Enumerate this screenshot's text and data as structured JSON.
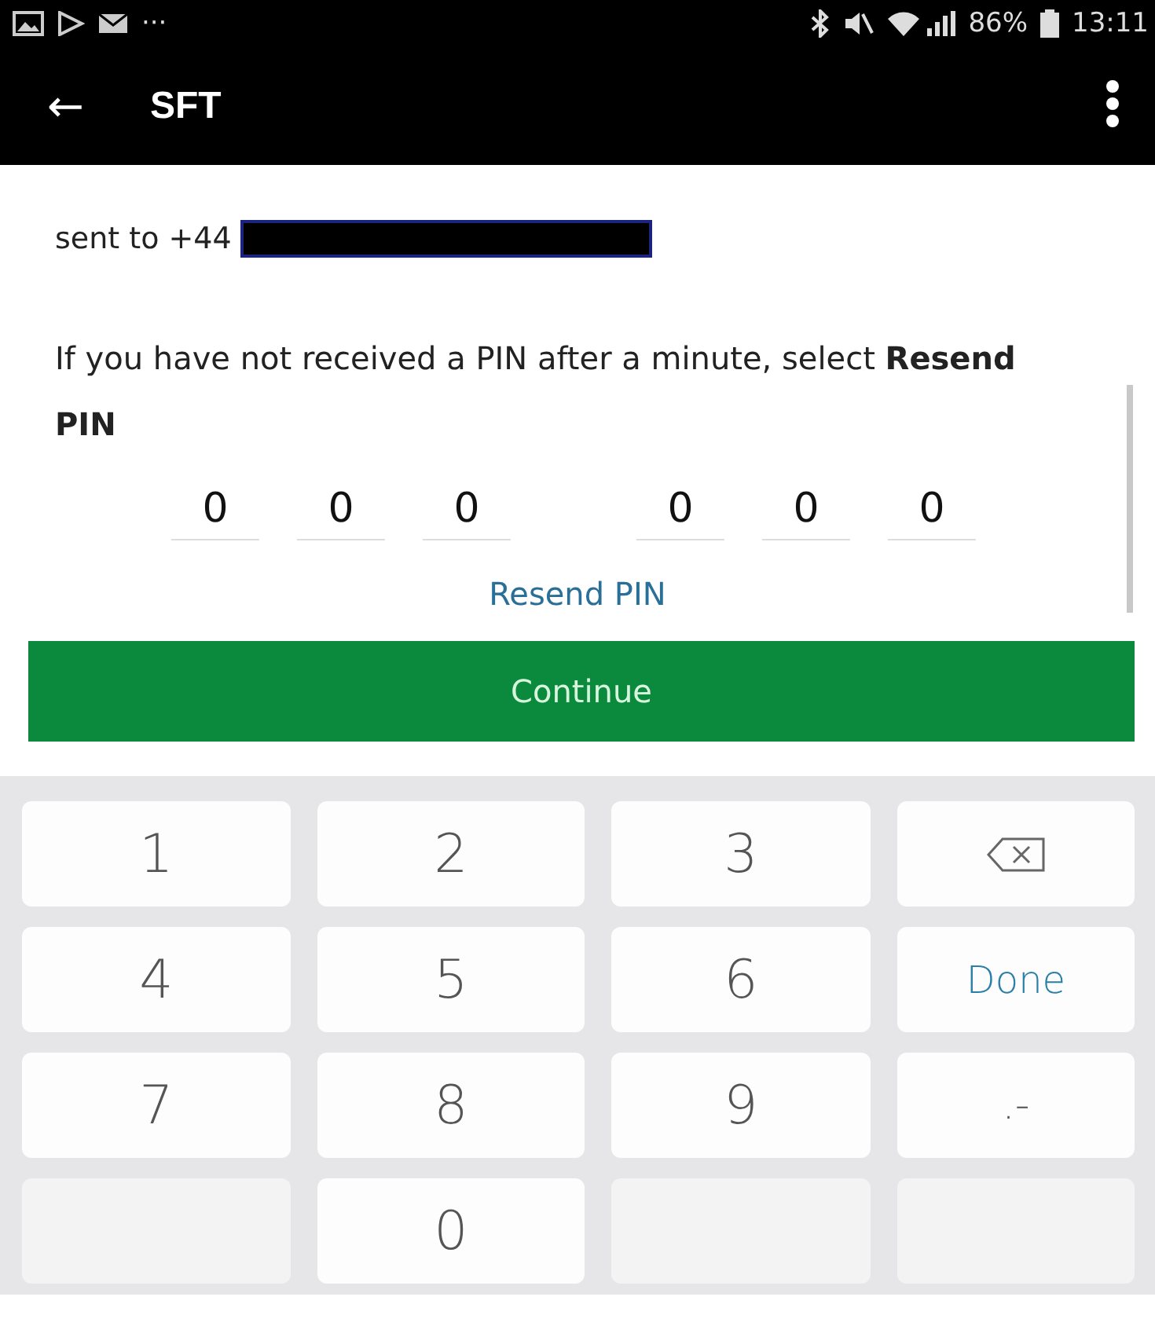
{
  "status_bar": {
    "overflow": "···",
    "battery_percent": "86%",
    "time": "13:11"
  },
  "app_bar": {
    "back": "←",
    "title": "SFT"
  },
  "sent_to": {
    "text": "sent to +44"
  },
  "instructions": "If you have not received a PIN after a minute, select **Resend PIN**",
  "pin_fields": [
    {
      "placeholder": "0"
    },
    {
      "placeholder": "0"
    },
    {
      "placeholder": "0"
    },
    {
      "placeholder": "0"
    },
    {
      "placeholder": "0"
    },
    {
      "placeholder": "0"
    }
  ],
  "resend_link": "Resend PIN",
  "continue_button": "Continue",
  "keyboard": [
    {
      "kind": "digit",
      "label": "1"
    },
    {
      "kind": "digit",
      "label": "2"
    },
    {
      "kind": "digit",
      "label": "3"
    },
    {
      "kind": "backspace"
    },
    {
      "kind": "digit",
      "label": "4"
    },
    {
      "kind": "digit",
      "label": "5"
    },
    {
      "kind": "digit",
      "label": "6"
    },
    {
      "kind": "done",
      "label": "Done"
    },
    {
      "kind": "digit",
      "label": "7"
    },
    {
      "kind": "digit",
      "label": "8"
    },
    {
      "kind": "digit",
      "label": "9"
    },
    {
      "kind": "symbol",
      "label": ".-"
    },
    {
      "kind": "blank"
    },
    {
      "kind": "digit",
      "label": "0"
    },
    {
      "kind": "blank"
    },
    {
      "kind": "blank"
    }
  ]
}
